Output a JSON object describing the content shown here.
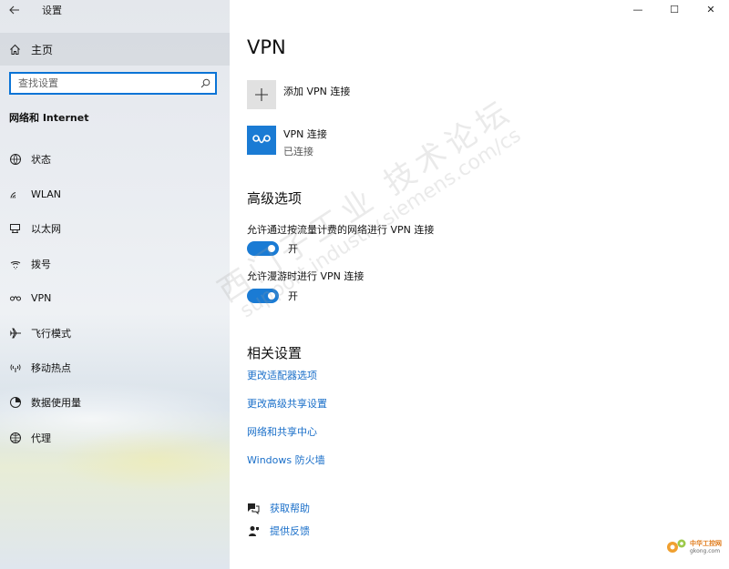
{
  "app": {
    "title": "设置"
  },
  "window_controls": {
    "minimize": "—",
    "maximize": "☐",
    "close": "✕"
  },
  "sidebar": {
    "home_label": "主页",
    "search": {
      "placeholder": "查找设置",
      "value": ""
    },
    "section_title": "网络和 Internet",
    "items": [
      {
        "label": "状态",
        "icon": "globe-status-icon"
      },
      {
        "label": "WLAN",
        "icon": "wifi-icon"
      },
      {
        "label": "以太网",
        "icon": "ethernet-icon"
      },
      {
        "label": "拨号",
        "icon": "dialup-icon"
      },
      {
        "label": "VPN",
        "icon": "vpn-icon"
      },
      {
        "label": "飞行模式",
        "icon": "airplane-icon"
      },
      {
        "label": "移动热点",
        "icon": "hotspot-icon"
      },
      {
        "label": "数据使用量",
        "icon": "data-usage-icon"
      },
      {
        "label": "代理",
        "icon": "proxy-globe-icon"
      }
    ]
  },
  "main": {
    "title": "VPN",
    "add_vpn_label": "添加 VPN 连接",
    "vpn_connection": {
      "name": "VPN 连接",
      "status": "已连接"
    },
    "advanced": {
      "title": "高级选项",
      "metered": {
        "label": "允许通过按流量计费的网络进行 VPN 连接",
        "state": "开",
        "on": true
      },
      "roaming": {
        "label": "允许漫游时进行 VPN 连接",
        "state": "开",
        "on": true
      }
    },
    "related": {
      "title": "相关设置",
      "links": [
        "更改适配器选项",
        "更改高级共享设置",
        "网络和共享中心",
        "Windows 防火墙"
      ]
    },
    "help": {
      "get_help": "获取帮助",
      "feedback": "提供反馈"
    }
  },
  "watermark": {
    "line1": "西门子工业 技术论坛",
    "line2": "support.industry.siemens.com/cs"
  },
  "corner_logo": {
    "line1": "中华工控网",
    "line2": "gkong.com"
  },
  "colors": {
    "accent": "#1a7bd4",
    "link": "#1a6fc9",
    "search_border": "#0a74d6"
  }
}
